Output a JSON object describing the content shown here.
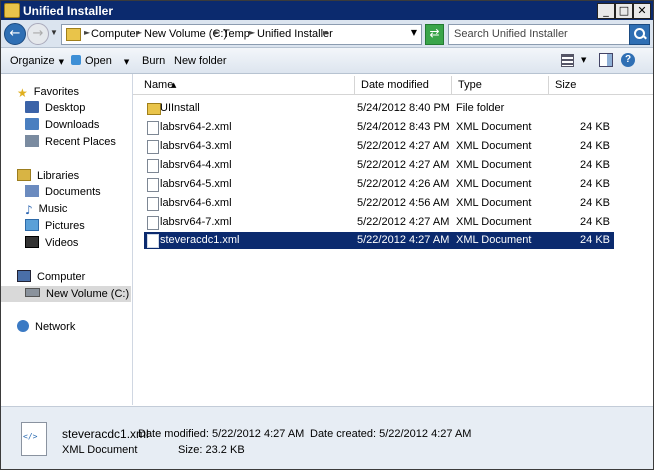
{
  "window": {
    "title": "Unified Installer",
    "controls": {
      "minimize": "_",
      "maximize": "□",
      "close": "✕"
    }
  },
  "address": {
    "back_glyph": "←",
    "forward_glyph": "→",
    "breadcrumbs": [
      "Computer",
      "New Volume (C:)",
      "Temp",
      "Unified Installer"
    ],
    "separator": "►",
    "dropdown": "▼",
    "refresh_glyph": "⇄",
    "search_placeholder": "Search Unified Installer"
  },
  "toolbar": {
    "organize": "Organize",
    "open": "Open",
    "burn": "Burn",
    "new_folder": "New folder",
    "arrow": "▼",
    "help": "?"
  },
  "nav": {
    "favorites": "Favorites",
    "desktop": "Desktop",
    "downloads": "Downloads",
    "recent_places": "Recent Places",
    "libraries": "Libraries",
    "documents": "Documents",
    "music": "Music",
    "pictures": "Pictures",
    "videos": "Videos",
    "computer": "Computer",
    "new_volume": "New Volume (C:)",
    "network": "Network",
    "star": "★",
    "note": "♪"
  },
  "columns": {
    "name": "Name",
    "sort": "▲",
    "date": "Date modified",
    "type": "Type",
    "size": "Size"
  },
  "files": [
    {
      "name": "UIInstall",
      "date": "5/24/2012 8:40 PM",
      "type": "File folder",
      "size": ""
    },
    {
      "name": "labsrv64-2.xml",
      "date": "5/24/2012 8:43 PM",
      "type": "XML Document",
      "size": "24 KB"
    },
    {
      "name": "labsrv64-3.xml",
      "date": "5/22/2012 4:27 AM",
      "type": "XML Document",
      "size": "24 KB"
    },
    {
      "name": "labsrv64-4.xml",
      "date": "5/22/2012 4:27 AM",
      "type": "XML Document",
      "size": "24 KB"
    },
    {
      "name": "labsrv64-5.xml",
      "date": "5/22/2012 4:26 AM",
      "type": "XML Document",
      "size": "24 KB"
    },
    {
      "name": "labsrv64-6.xml",
      "date": "5/22/2012 4:56 AM",
      "type": "XML Document",
      "size": "24 KB"
    },
    {
      "name": "labsrv64-7.xml",
      "date": "5/22/2012 4:27 AM",
      "type": "XML Document",
      "size": "24 KB"
    },
    {
      "name": "steveracdc1.xml",
      "date": "5/22/2012 4:27 AM",
      "type": "XML Document",
      "size": "24 KB"
    }
  ],
  "details": {
    "filename": "steveracdc1.xml",
    "date_modified": "Date modified: 5/22/2012 4:27 AM",
    "date_created": "Date created: 5/22/2012 4:27 AM",
    "type": "XML Document",
    "size": "Size: 23.2 KB"
  }
}
